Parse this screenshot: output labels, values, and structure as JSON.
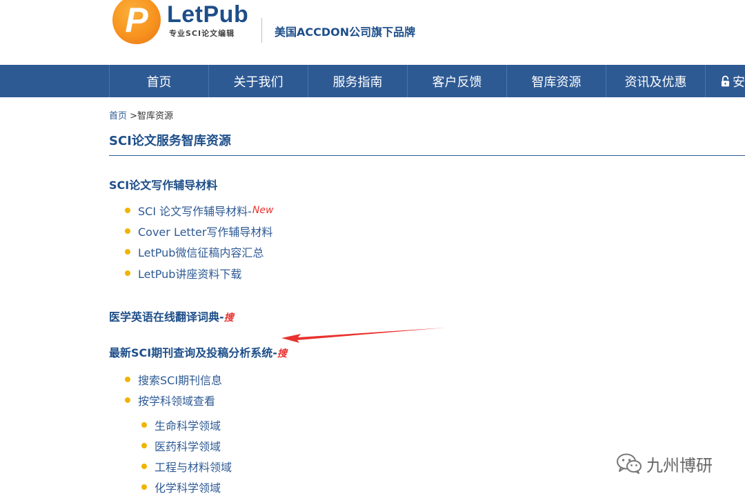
{
  "header": {
    "logo_letter": "P",
    "logo_name": "LetPub",
    "logo_tagline": "专业SCI论文编辑",
    "brand_text": "美国ACCDON公司旗下品牌"
  },
  "nav": {
    "items": [
      {
        "label": "首页"
      },
      {
        "label": "关于我们"
      },
      {
        "label": "服务指南"
      },
      {
        "label": "客户反馈"
      },
      {
        "label": "智库资源"
      },
      {
        "label": "资讯及优惠"
      },
      {
        "label": "安"
      }
    ]
  },
  "breadcrumb": {
    "home": "首页",
    "separator": " >",
    "current": "智库资源"
  },
  "page_title": "SCI论文服务智库资源",
  "sections": {
    "writing": {
      "heading": "SCI论文写作辅导材料",
      "items": [
        {
          "label": "SCI 论文写作辅导材料-",
          "badge": "New"
        },
        {
          "label": "Cover Letter写作辅导材料"
        },
        {
          "label": "LetPub微信征稿内容汇总"
        },
        {
          "label": "LetPub讲座资料下载"
        }
      ]
    },
    "dictionary": {
      "heading": "医学英语在线翻译词典-",
      "search_tag": "搜"
    },
    "journal": {
      "heading": "最新SCI期刊查询及投稿分析系统-",
      "search_tag": "搜",
      "items": [
        {
          "label": "搜索SCI期刊信息"
        },
        {
          "label": "按学科领域查看"
        }
      ],
      "subitems": [
        {
          "label": "生命科学领域"
        },
        {
          "label": "医药科学领域"
        },
        {
          "label": "工程与材料领域"
        },
        {
          "label": "化学科学领域"
        }
      ]
    }
  },
  "watermark": {
    "text": "九州博研",
    "icon": "wechat-icon"
  },
  "colors": {
    "nav_bg": "#2e5a94",
    "heading": "#1d4e89",
    "link": "#2e5a94",
    "bullet": "#f0b400",
    "accent_red": "#e8322e",
    "logo_orange": "#f7931e"
  }
}
